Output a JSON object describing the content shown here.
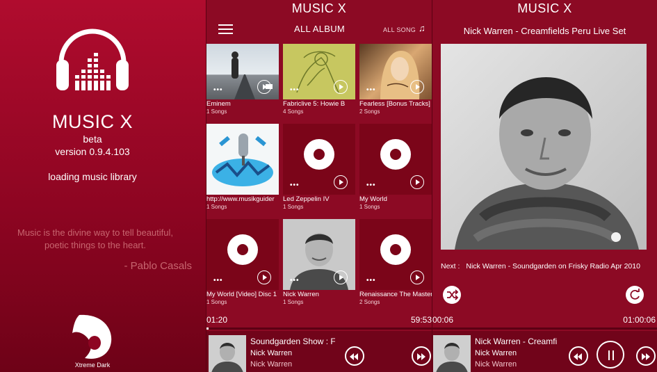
{
  "splash": {
    "app_name": "MUSIC X",
    "beta": "beta",
    "version": "version 0.9.4.103",
    "loading": "loading music library",
    "quote_line1": "Music is the divine way to tell beautiful,",
    "quote_line2": "poetic things to the heart.",
    "quote_author": "- Pablo Casals",
    "bottom_logo_label": "Xtreme Dark"
  },
  "library": {
    "title": "MUSIC X",
    "tab_all_album": "ALL ALBUM",
    "tab_all_song": "ALL SONG",
    "albums": [
      {
        "name": "Eminem",
        "count": "1 Songs",
        "art": "road-photo"
      },
      {
        "name": "Fabriclive 5: Howie B",
        "count": "4 Songs",
        "art": "sketch-cover"
      },
      {
        "name": "Fearless [Bonus Tracks]",
        "count": "2 Songs",
        "art": "portrait-cover"
      },
      {
        "name": "http://www.musikguider",
        "count": "1 Songs",
        "art": "graffiti-cover"
      },
      {
        "name": "Led Zeppelin IV",
        "count": "1 Songs",
        "art": "disc-placeholder"
      },
      {
        "name": "My World",
        "count": "1 Songs",
        "art": "disc-placeholder"
      },
      {
        "name": "My World [Video] Disc 1",
        "count": "1 Songs",
        "art": "disc-placeholder"
      },
      {
        "name": "Nick Warren",
        "count": "1 Songs",
        "art": "artist-photo"
      },
      {
        "name": "Renaissance The Master",
        "count": "2 Songs",
        "art": "disc-placeholder"
      }
    ],
    "time_elapsed": "01:20",
    "time_total": "59:53",
    "progress": 0.01,
    "now_playing": {
      "title": "Soundgarden Show : F",
      "artist": "Nick Warren",
      "album": "Nick Warren"
    }
  },
  "player": {
    "title": "MUSIC X",
    "song": "Nick Warren - Creamfields Peru Live Set",
    "next_prefix": "Next :",
    "next_song": "Nick Warren - Soundgarden on Frisky Radio Apr 2010",
    "time_elapsed": "00:06",
    "time_total": "01:00:06",
    "progress": 0.0,
    "now_playing": {
      "title": "Nick Warren - Creamfi",
      "artist": "Nick Warren",
      "album": "Nick Warren"
    }
  },
  "colors": {
    "background": "#8c0a24",
    "splash_top": "#b00c2e",
    "now_playing_bar": "#71041a",
    "text": "#ffffff"
  }
}
